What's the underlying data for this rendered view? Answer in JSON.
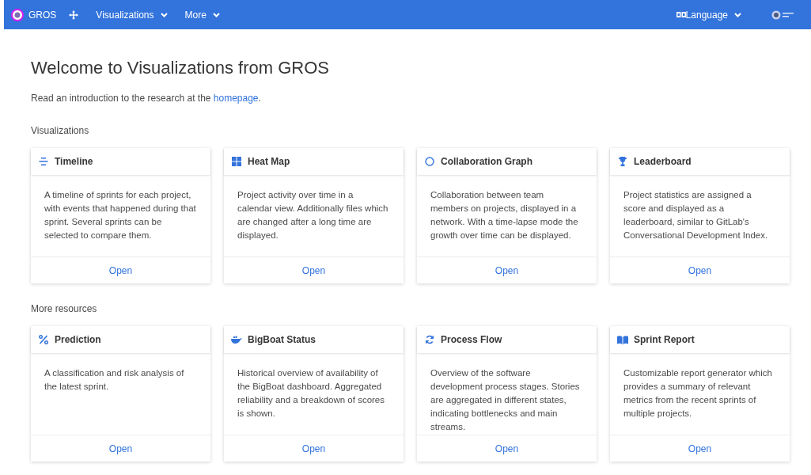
{
  "navbar": {
    "brand": "GROS",
    "menus": [
      {
        "label": "Visualizations"
      },
      {
        "label": "More"
      }
    ],
    "language": {
      "label": "Language"
    }
  },
  "page": {
    "title": "Welcome to Visualizations from GROS",
    "intro": "Read an introduction to the research at the ",
    "intro_link": "homepage",
    "intro_end": "."
  },
  "sections": [
    {
      "heading": "Visualizations",
      "cards": [
        {
          "kind": "timeline",
          "title": "Timeline",
          "text": "A timeline of sprints for each project, with events that happened during that sprint. Several sprints can be selected to compare them.",
          "action": "Open"
        },
        {
          "kind": "heatmap",
          "title": "Heat Map",
          "text": "Project activity over time in a calendar view. Additionally files which are changed after a long time are displayed.",
          "action": "Open"
        },
        {
          "kind": "graph",
          "title": "Collaboration Graph",
          "text": "Collaboration between team members on projects, displayed in a network. With a time-lapse mode the growth over time can be displayed.",
          "action": "Open"
        },
        {
          "kind": "trophy",
          "title": "Leaderboard",
          "text": "Project statistics are assigned a score and displayed as a leaderboard, similar to GitLab's Conversational Development Index.",
          "action": "Open"
        }
      ]
    },
    {
      "heading": "More resources",
      "cards": [
        {
          "kind": "percent",
          "title": "Prediction",
          "text": "A classification and risk analysis of the latest sprint.",
          "action": "Open"
        },
        {
          "kind": "whale",
          "title": "BigBoat Status",
          "text": "Historical overview of availability of the BigBoat dashboard. Aggregated reliability and a breakdown of scores is shown.",
          "action": "Open"
        },
        {
          "kind": "sync",
          "title": "Process Flow",
          "text": "Overview of the software development process stages. Stories are aggregated in different states, indicating bottlenecks and main streams.",
          "action": "Open"
        },
        {
          "kind": "book",
          "title": "Sprint Report",
          "text": "Customizable report generator which provides a summary of relevant metrics from the recent sprints of multiple projects.",
          "action": "Open"
        }
      ]
    }
  ]
}
